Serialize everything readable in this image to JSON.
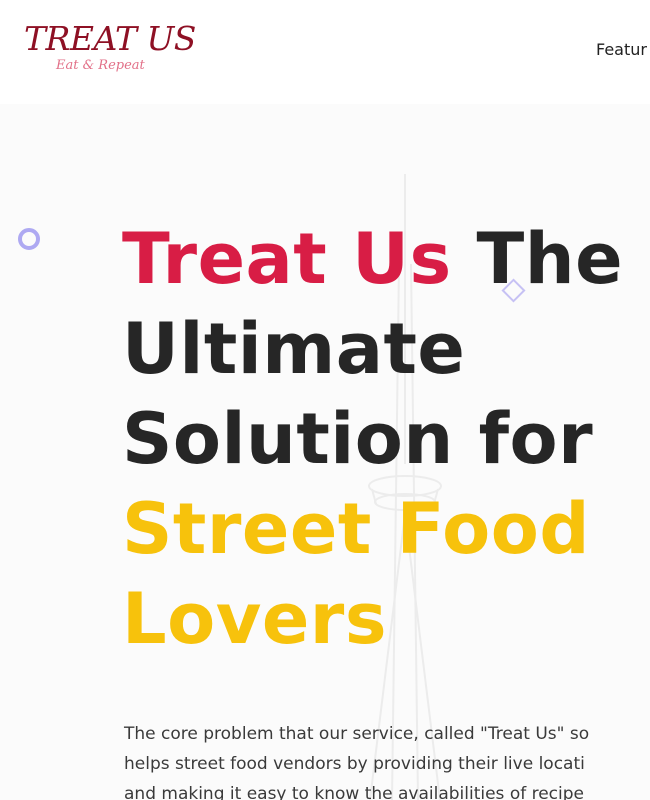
{
  "logo": {
    "title": "TREAT US",
    "tagline": "Eat & Repeat"
  },
  "nav": {
    "features_label": "Featur"
  },
  "hero": {
    "headline_brand": "Treat Us",
    "headline_the": " The",
    "headline_line2": "Ultimate",
    "headline_line3": "Solution for",
    "headline_line4": "Street Food",
    "headline_line5": "Lovers",
    "description_lines": [
      "The core problem that our service, called \"Treat Us\" so",
      "helps street food vendors by providing their live locati",
      "and making it easy to know the availabilities of recipe"
    ]
  },
  "colors": {
    "brand_red": "#d81d45",
    "accent_yellow": "#f7c20c",
    "logo_maroon": "#8e1024",
    "logo_pink": "#e27088",
    "deco_purple": "#aea9f2"
  },
  "icons": {
    "circle": "decorative-circle-icon",
    "diamond": "decorative-diamond-icon",
    "background": "cn-tower-illustration"
  }
}
